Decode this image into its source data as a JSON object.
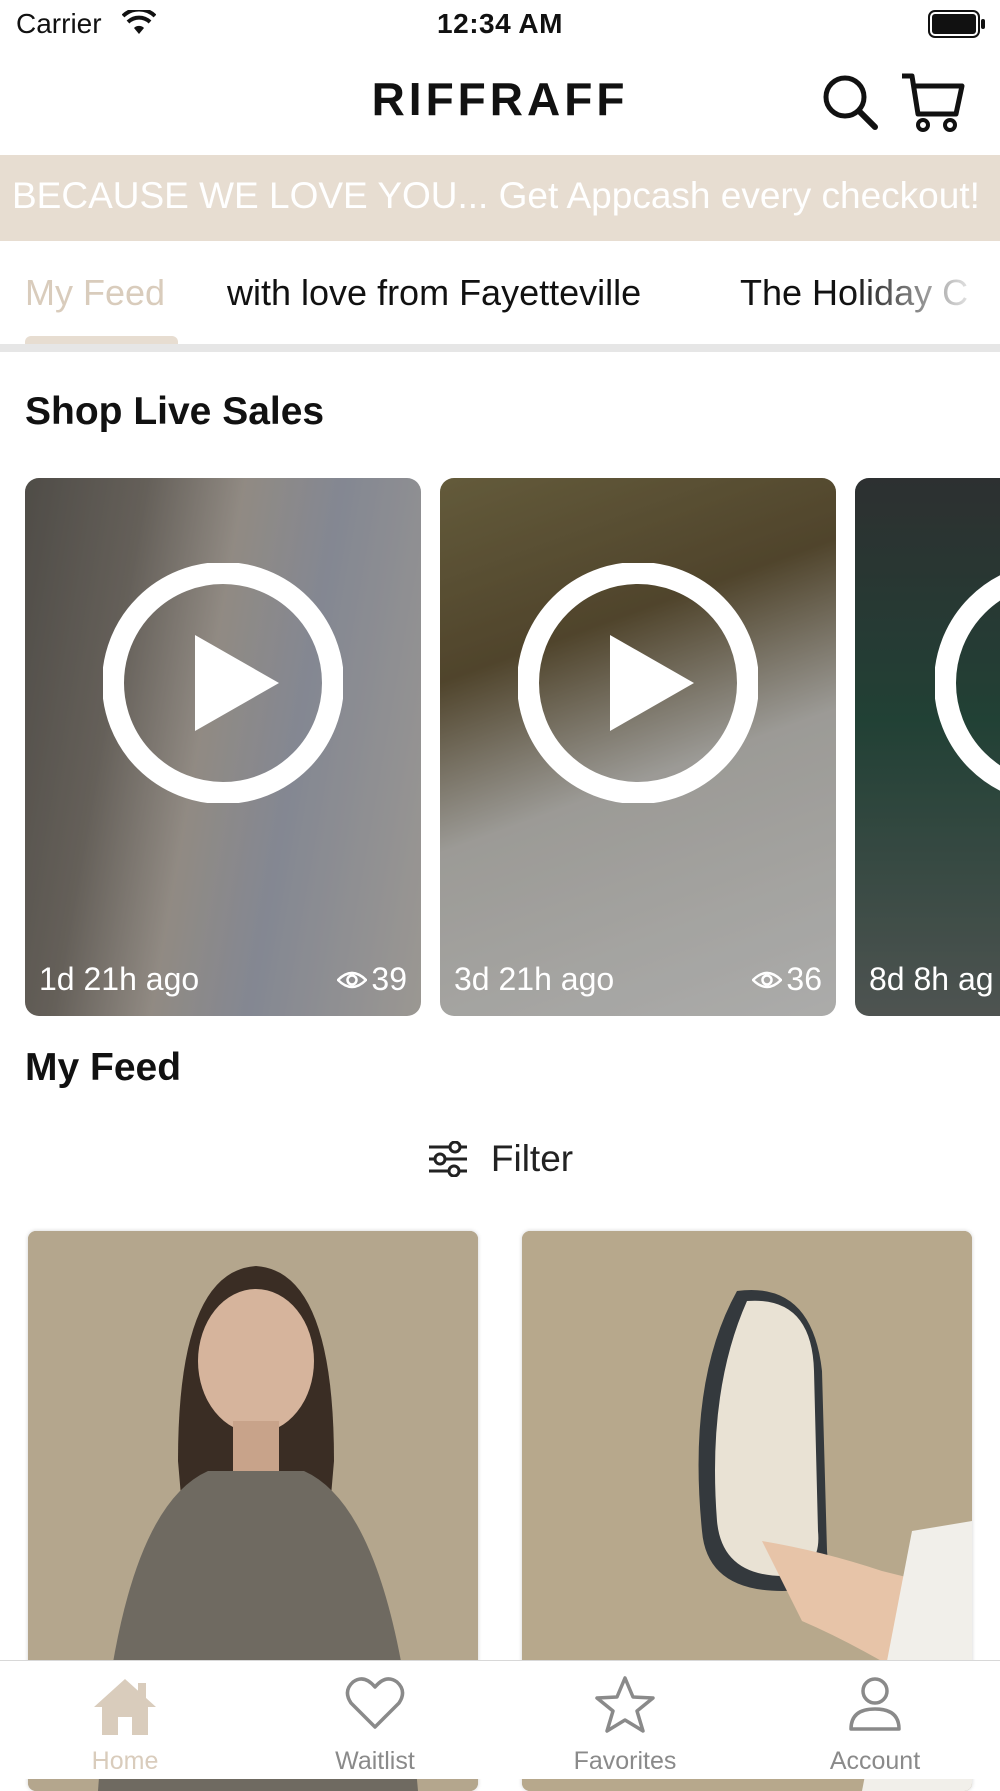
{
  "status_bar": {
    "carrier": "Carrier",
    "time": "12:34 AM"
  },
  "header": {
    "brand": "RIFFRAFF"
  },
  "banner": {
    "text": "BECAUSE WE LOVE YOU... Get Appcash every checkout!"
  },
  "tabs": [
    {
      "label": "My Feed",
      "active": true
    },
    {
      "label": "with love from Fayetteville",
      "active": false
    },
    {
      "label": "The Holiday C",
      "active": false
    }
  ],
  "live_sales": {
    "title": "Shop Live Sales",
    "cards": [
      {
        "ago": "1d 21h ago",
        "views": "39"
      },
      {
        "ago": "3d 21h ago",
        "views": "36"
      },
      {
        "ago": "8d 8h ag",
        "views": ""
      }
    ]
  },
  "feed": {
    "title": "My Feed",
    "filter_label": "Filter"
  },
  "bottom_nav": [
    {
      "label": "Home",
      "icon": "home-icon",
      "active": true
    },
    {
      "label": "Waitlist",
      "icon": "heart-icon",
      "active": false
    },
    {
      "label": "Favorites",
      "icon": "star-icon",
      "active": false
    },
    {
      "label": "Account",
      "icon": "person-icon",
      "active": false
    }
  ],
  "colors": {
    "accent": "#d9ccbc",
    "banner_bg": "#e7ddd1",
    "text": "#111111",
    "inactive": "#8a8a8a"
  }
}
